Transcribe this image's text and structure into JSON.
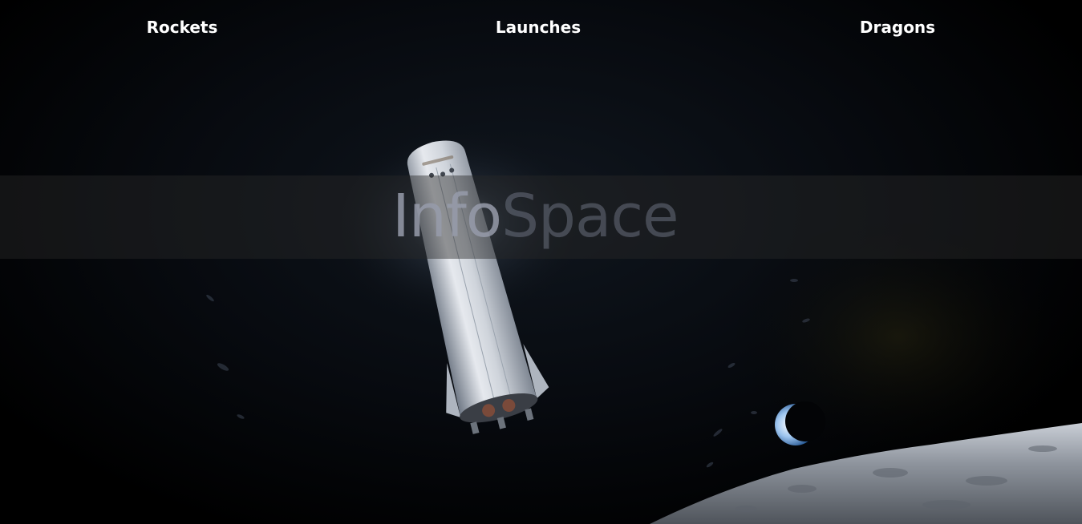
{
  "nav": {
    "items": [
      "Rockets",
      "Launches",
      "Dragons"
    ]
  },
  "banner": {
    "title_part1": "Info",
    "title_part2": "Space"
  },
  "background": {
    "scene": "starship-over-moon-with-earth-crescent"
  },
  "colors": {
    "background": "#000000",
    "nav_text": "#ffffff",
    "banner_overlay": "#282828"
  }
}
